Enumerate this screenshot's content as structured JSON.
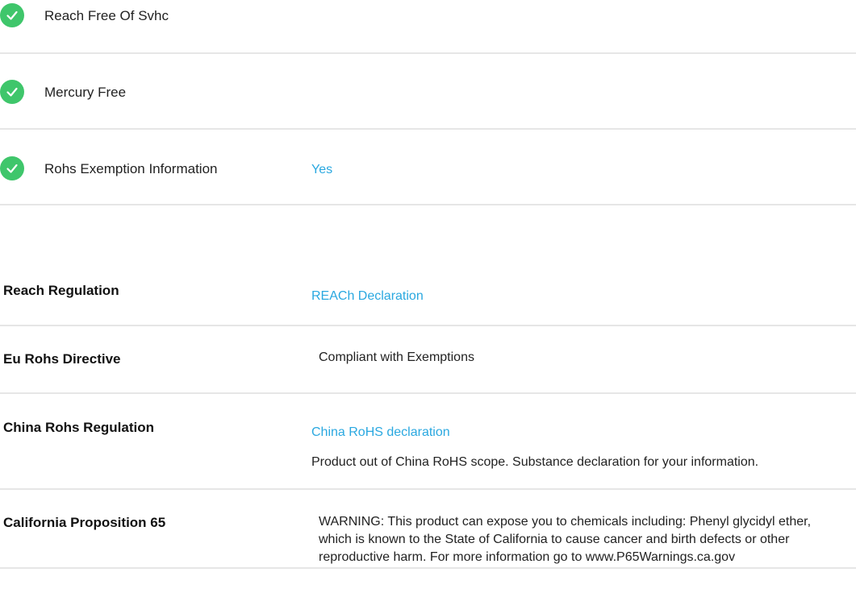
{
  "features": [
    {
      "label": "Reach Free Of Svhc",
      "value": ""
    },
    {
      "label": "Mercury Free",
      "value": ""
    },
    {
      "label": "Rohs Exemption Information",
      "value": "Yes"
    }
  ],
  "regulations": {
    "reach": {
      "label": "Reach Regulation",
      "link": "REACh Declaration"
    },
    "eu_rohs": {
      "label": "Eu Rohs Directive",
      "text": "Compliant with Exemptions"
    },
    "china_rohs": {
      "label": "China Rohs Regulation",
      "link": "China RoHS declaration",
      "text": "Product out of China RoHS scope. Substance declaration for your information."
    },
    "prop65": {
      "label": "California Proposition 65",
      "text": "WARNING: This product can expose you to chemicals including: Phenyl glycidyl ether, which is known to the State of California to cause cancer and birth defects or other reproductive harm. For more information go to www.P65Warnings.ca.gov"
    }
  },
  "colors": {
    "check": "#3fc66b",
    "link": "#2aa8e0",
    "divider": "#e6e6e6"
  },
  "icons": {
    "check": "check-circle-icon"
  }
}
